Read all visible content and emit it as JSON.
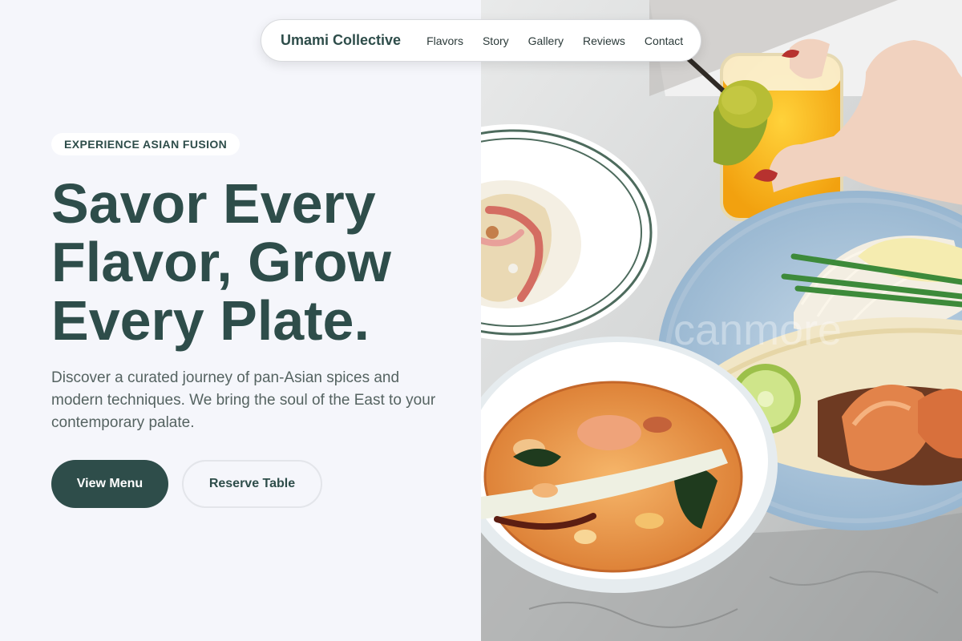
{
  "nav": {
    "brand": "Umami Collective",
    "links": [
      "Flavors",
      "Story",
      "Gallery",
      "Reviews",
      "Contact"
    ]
  },
  "hero": {
    "eyebrow": "EXPERIENCE ASIAN FUSION",
    "title_lines": [
      "Savor Every",
      "Flavor, Grow",
      "Every Plate."
    ],
    "description": "Discover a curated journey of pan-Asian spices and modern techniques. We bring the soul of the East to your contemporary palate.",
    "primary_button": "View Menu",
    "secondary_button": "Reserve Table"
  },
  "photo": {
    "watermark": "canmore"
  },
  "colors": {
    "brand_dark": "#2e4d4a",
    "background": "#f5f6fb",
    "body_text": "#556361"
  }
}
